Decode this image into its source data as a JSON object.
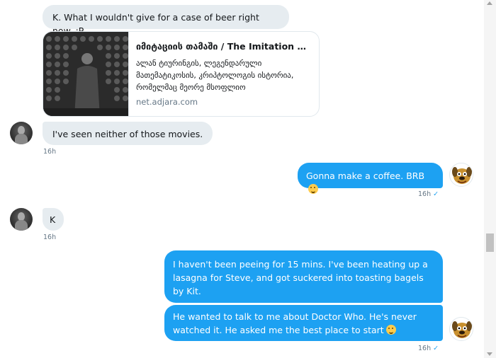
{
  "messages": {
    "m1": {
      "text": "K. What I wouldn't give for a case of beer right now. :P"
    },
    "card": {
      "title": "იმიტაციის თამაში / The Imitation G…",
      "description": "ალან ტიურინგის, ლეგენდარული მათემატიკოსის, კრიპტოლოგის ისტორია, რომელმაც მეორე მსოფლიო",
      "domain": "net.adjara.com"
    },
    "m2": {
      "text": "I've seen neither of those movies.",
      "time": "16h"
    },
    "m3": {
      "text": "Gonna make a coffee. BRB",
      "time": "16h",
      "emoji": "face-blowing-kiss-emoji"
    },
    "m4": {
      "text": "K",
      "time": "16h"
    },
    "m5": {
      "text": "I haven't been peeing for 15 mins. I've been heating up a lasagna for Steve, and got suckered into toasting bagels by Kit."
    },
    "m6": {
      "text": "He wanted to talk to me about Doctor Who. He's never watched it. He asked me the best place to start",
      "time": "16h",
      "emoji": "rofl-emoji"
    }
  },
  "read_check": "✓",
  "colors": {
    "incoming_bubble": "#e6ecf0",
    "outgoing_bubble": "#1da1f2",
    "meta": "#657786"
  }
}
